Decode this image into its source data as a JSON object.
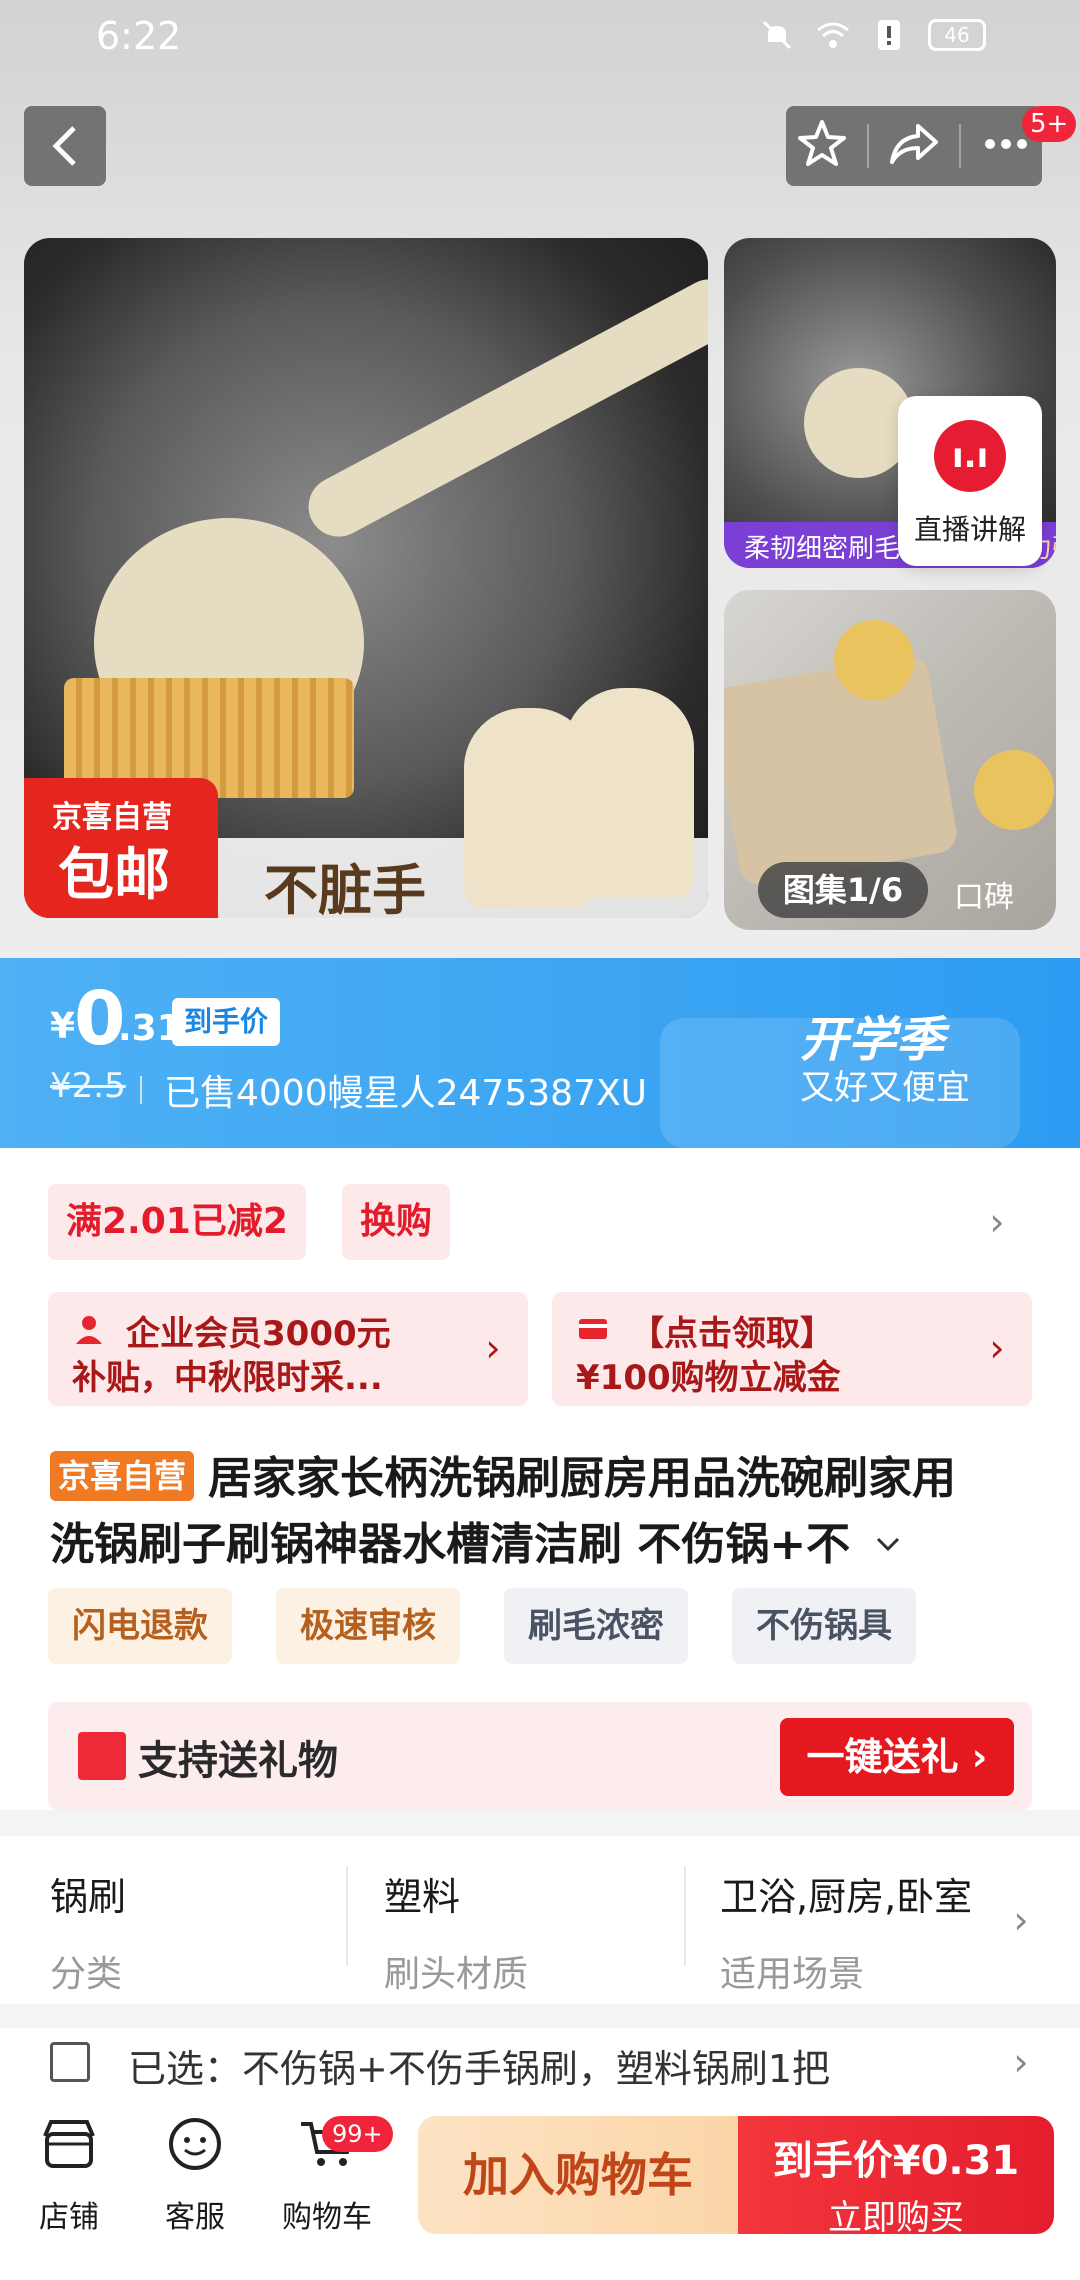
{
  "status_bar": {
    "time": "6:22",
    "battery": "46"
  },
  "header": {
    "cart_badge": "5+"
  },
  "gallery": {
    "main_badge_top": "京喜自营",
    "main_badge_bottom": "包邮",
    "main_caption": "不脏手",
    "side_caption_left": "柔韧细密刷毛",
    "side_caption_right": "清洁力强",
    "live_label": "直播讲解",
    "gallery_counter": "图集1/6",
    "koubei": "口碑"
  },
  "price": {
    "currency": "¥",
    "integer": "0",
    "decimal": ".31",
    "chip": "到手价",
    "original": "¥2.5",
    "sold_info": "已售4000幔星人2475387XU",
    "promo_title": "开学季",
    "promo_sub": "又好又便宜"
  },
  "promotions": {
    "tag1": "满2.01已减2",
    "tag2": "换购",
    "coupon1_line1": "企业会员3000元",
    "coupon1_line2": "补贴，中秋限时采...",
    "coupon2_line1": "【点击领取】",
    "coupon2_line2": "¥100购物立减金"
  },
  "product": {
    "store_badge": "京喜自营",
    "title_line1": "居家家长柄洗锅刷厨房用品洗碗刷家用",
    "title_line2": "洗锅刷子刷锅神器水槽清洁刷 不伤锅+不",
    "features": [
      "闪电退款",
      "极速审核",
      "刷毛浓密",
      "不伤锅具"
    ]
  },
  "gift": {
    "label": "支持送礼物",
    "button": "一键送礼 ›"
  },
  "specs": [
    {
      "value": "锅刷",
      "key": "分类"
    },
    {
      "value": "塑料",
      "key": "刷头材质"
    },
    {
      "value": "卫浴,厨房,卧室",
      "key": "适用场景"
    }
  ],
  "selected": {
    "text": "已选：不伤锅+不伤手锅刷，塑料锅刷1把"
  },
  "bottom_bar": {
    "store": "店铺",
    "service": "客服",
    "cart": "购物车",
    "cart_badge": "99+",
    "add_cart": "加入购物车",
    "buy_price": "到手价¥0.31",
    "buy_label": "立即购买"
  },
  "colors": {
    "accent_red": "#e5171f",
    "price_blue": "#2d9cf2",
    "badge_orange": "#f07a23"
  }
}
